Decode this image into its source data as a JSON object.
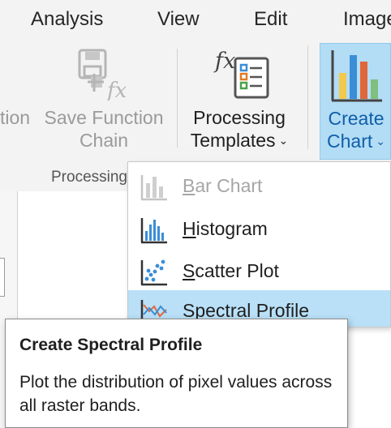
{
  "tabs": [
    "Analysis",
    "View",
    "Edit",
    "Image"
  ],
  "ribbon": {
    "partial_button_label": "tion",
    "save_function_chain": {
      "line1": "Save Function",
      "line2": "Chain"
    },
    "processing_templates": {
      "line1": "Processing",
      "line2": "Templates"
    },
    "create_chart": {
      "line1": "Create",
      "line2": "Chart"
    },
    "group_label": "Processing"
  },
  "menu": {
    "items": [
      {
        "pre": "",
        "mnemonic": "B",
        "post": "ar Chart",
        "icon": "bar-chart-icon",
        "state": "disabled"
      },
      {
        "pre": "",
        "mnemonic": "H",
        "post": "istogram",
        "icon": "histogram-icon",
        "state": "normal"
      },
      {
        "pre": "",
        "mnemonic": "S",
        "post": "catter Plot",
        "icon": "scatter-plot-icon",
        "state": "normal"
      },
      {
        "pre": "Spect",
        "mnemonic": "r",
        "post": "al Profile",
        "icon": "spectral-profile-icon",
        "state": "selected"
      }
    ]
  },
  "tooltip": {
    "title": "Create Spectral Profile",
    "body": "Plot the distribution of pixel values across all raster bands."
  },
  "colors": {
    "selected_bg": "#b9e0f7",
    "chart_button_bg": "#b3dcf5",
    "accent_text": "#0f5fa8"
  }
}
